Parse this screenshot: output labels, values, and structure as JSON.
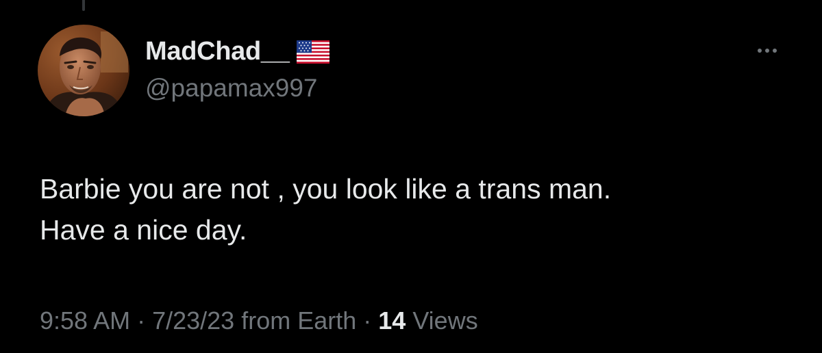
{
  "tweet": {
    "author": {
      "display_name": "MadChad__",
      "flag_icon": "us-flag-icon",
      "handle": "@papamax997",
      "avatar_icon": "avatar-photo"
    },
    "more_icon": "more-options-icon",
    "text_lines": [
      "Barbie you are not , you look like a trans man.",
      "Have a nice day."
    ],
    "meta": {
      "time": "9:58 AM",
      "separator": "·",
      "date": "7/23/23",
      "source": "from Earth",
      "views_count": "14",
      "views_label": "Views"
    }
  },
  "colors": {
    "background": "#000000",
    "primary_text": "#e7e9ea",
    "secondary_text": "#71767b",
    "thread_line": "#333639"
  }
}
